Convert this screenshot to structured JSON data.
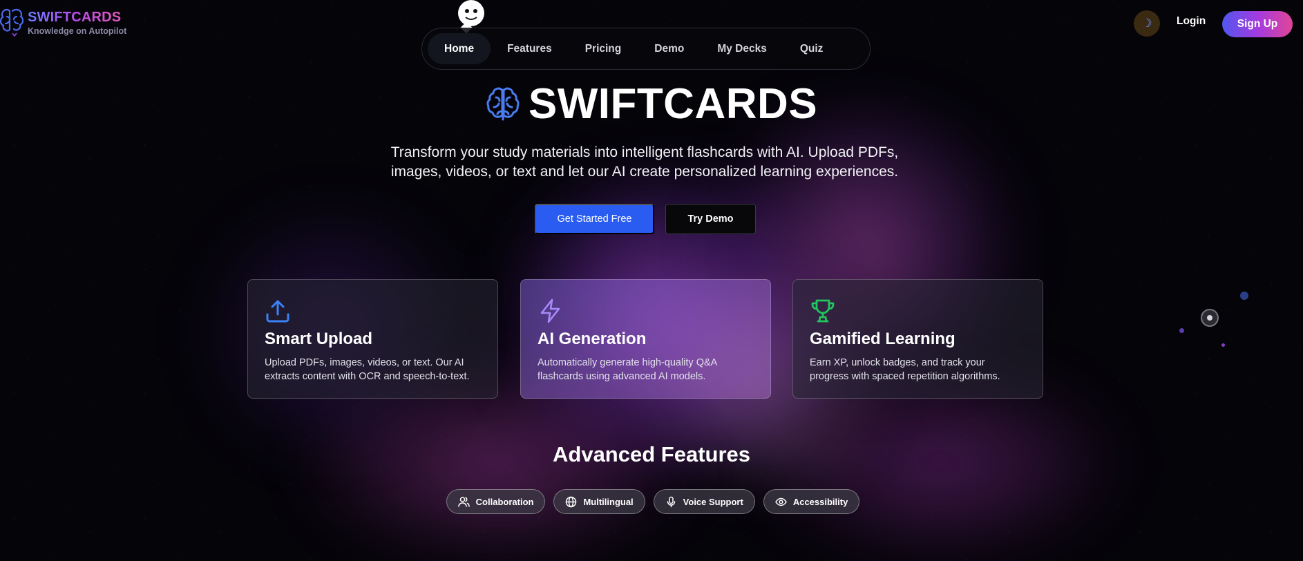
{
  "brand": {
    "name": "SWIFTCARDS",
    "tagline": "Knowledge on Autopilot"
  },
  "nav": {
    "items": [
      {
        "label": "Home",
        "active": true
      },
      {
        "label": "Features"
      },
      {
        "label": "Pricing"
      },
      {
        "label": "Demo"
      },
      {
        "label": "My Decks"
      },
      {
        "label": "Quiz"
      }
    ]
  },
  "header": {
    "theme_toggle_icon": "☽",
    "login_label": "Login",
    "signup_label": "Sign Up"
  },
  "hero": {
    "title": "SWIFTCARDS",
    "description": "Transform your study materials into intelligent flashcards with AI. Upload PDFs, images, videos, or text and let our AI create personalized learning experiences.",
    "primary_cta": "Get Started Free",
    "secondary_cta": "Try Demo"
  },
  "features": [
    {
      "title": "Smart Upload",
      "description": "Upload PDFs, images, videos, or text. Our AI extracts content with OCR and speech-to-text.",
      "icon": "upload-icon",
      "icon_color": "#3b82f6"
    },
    {
      "title": "AI Generation",
      "description": "Automatically generate high-quality Q&A flashcards using advanced AI models.",
      "icon": "lightning-icon",
      "icon_color": "#a78bfa"
    },
    {
      "title": "Gamified Learning",
      "description": "Earn XP, unlock badges, and track your progress with spaced repetition algorithms.",
      "icon": "trophy-icon",
      "icon_color": "#22c55e"
    }
  ],
  "advanced": {
    "title": "Advanced Features",
    "pills": [
      {
        "label": "Collaboration",
        "icon": "users-icon"
      },
      {
        "label": "Multilingual",
        "icon": "globe-icon"
      },
      {
        "label": "Voice Support",
        "icon": "microphone-icon"
      },
      {
        "label": "Accessibility",
        "icon": "eye-icon"
      }
    ]
  },
  "colors": {
    "primary": "#2a5cf2",
    "brand_gradient": [
      "#6b7dff",
      "#c04cf0",
      "#e65ab4"
    ],
    "background": "#050409"
  }
}
